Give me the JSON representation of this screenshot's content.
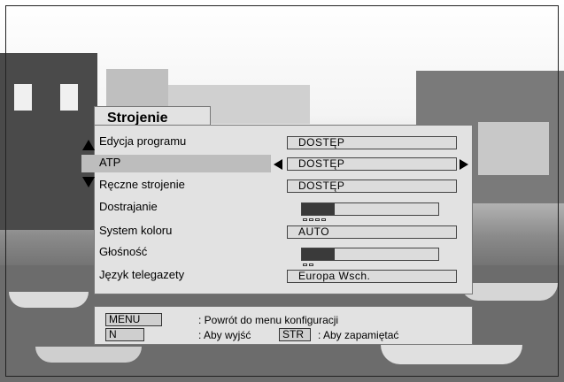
{
  "menu": {
    "title": "Strojenie",
    "rows": [
      {
        "label": "Edycja programu",
        "value": "DOSTĘP"
      },
      {
        "label": "ATP",
        "value": "DOSTĘP"
      },
      {
        "label": "Ręczne strojenie",
        "value": "DOSTĘP"
      },
      {
        "label": "Dostrajanie",
        "level": 0.24
      },
      {
        "label": "System koloru",
        "value": "AUTO"
      },
      {
        "label": "Głośność",
        "level": 0.24
      },
      {
        "label": "Język telegazety",
        "value": "Europa Wsch."
      }
    ]
  },
  "footer": {
    "menu_key": "MENU",
    "menu_text": ": Powrót do menu konfiguracji",
    "n_key": "N",
    "n_text": ": Aby wyjść",
    "str_key": "STR",
    "str_text": ": Aby zapamiętać"
  },
  "colors": {
    "panel": "#e2e2e2",
    "selected_row": "#bdbdbd",
    "bar_fill": "#3a3a3a"
  },
  "icons": {
    "up": "triangle-up-icon",
    "down": "triangle-down-icon",
    "left": "triangle-left-icon",
    "right": "triangle-right-icon"
  }
}
